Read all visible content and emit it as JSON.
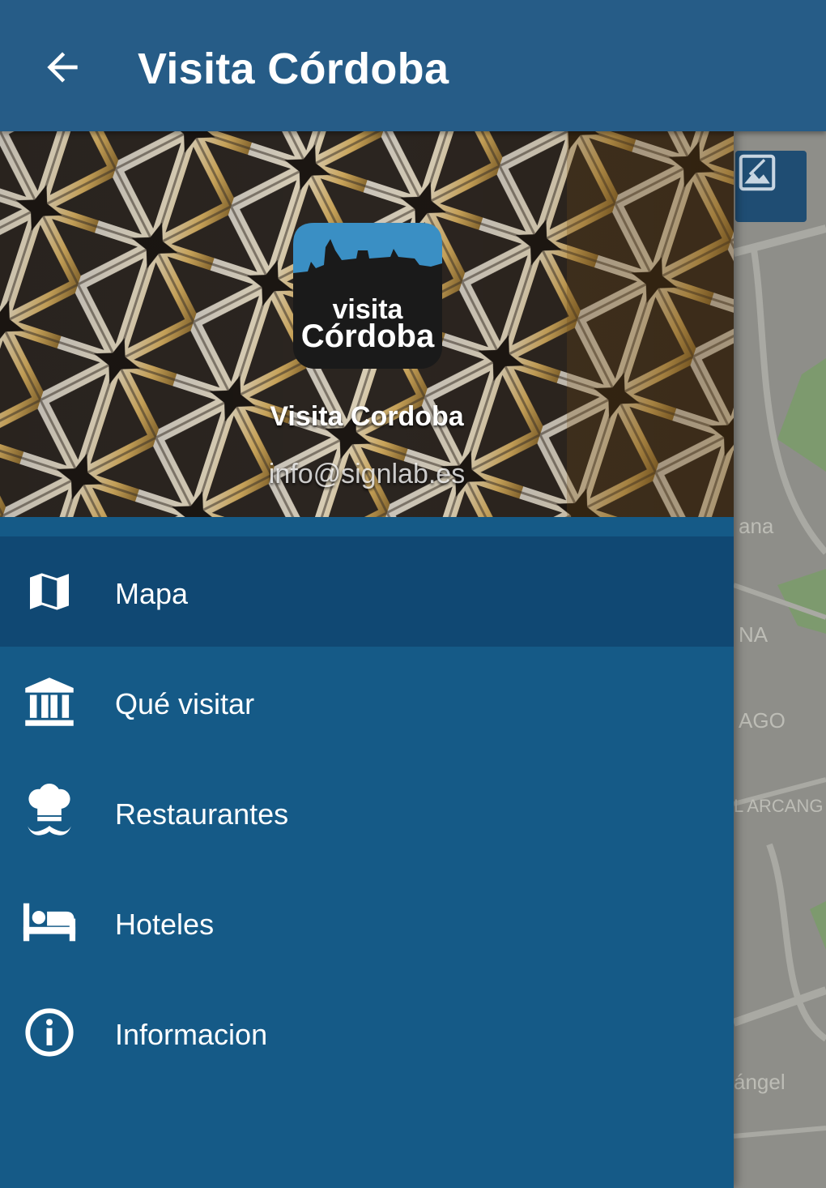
{
  "app_bar": {
    "title": "Visita Córdoba",
    "back_icon": "arrow-back-icon"
  },
  "drawer": {
    "header": {
      "logo": {
        "line1": "visita",
        "line2": "Córdoba"
      },
      "name": "Visita Cordoba",
      "email": "info@signlab.es"
    },
    "items": [
      {
        "label": "Mapa",
        "icon": "map-icon",
        "selected": true
      },
      {
        "label": "Qué visitar",
        "icon": "museum-icon",
        "selected": false
      },
      {
        "label": "Restaurantes",
        "icon": "chef-icon",
        "selected": false
      },
      {
        "label": "Hoteles",
        "icon": "hotel-bed-icon",
        "selected": false
      },
      {
        "label": "Informacion",
        "icon": "info-icon",
        "selected": false
      }
    ]
  },
  "map": {
    "labels": [
      "ana",
      "NA",
      "AGO",
      "L ARCANG",
      "ángel"
    ],
    "layers_button_icon": "map-layers-icon"
  },
  "colors": {
    "app_bar": "#265c87",
    "drawer": "#155a87",
    "selected_item": "#104873",
    "text": "#ffffff"
  }
}
